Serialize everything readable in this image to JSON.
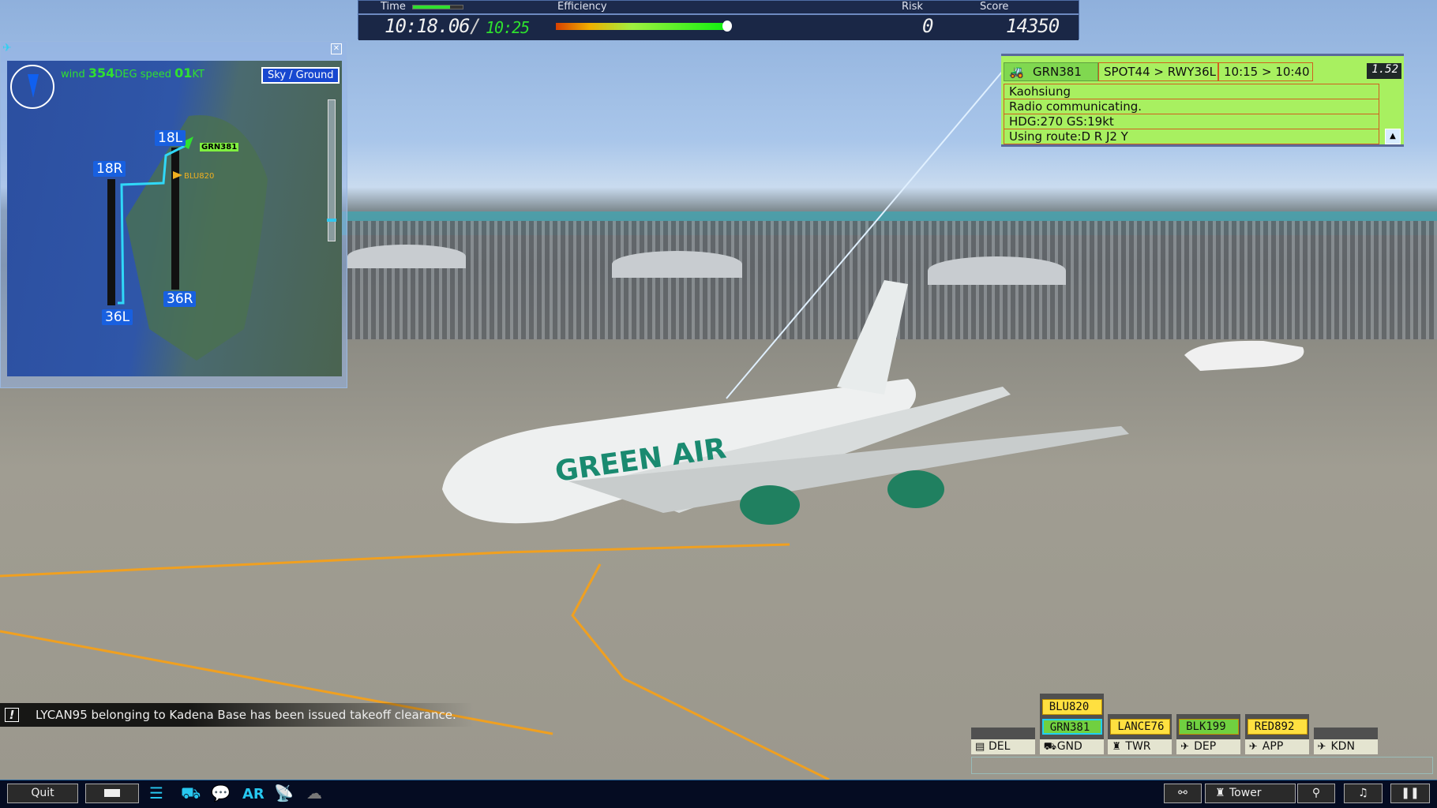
{
  "hud": {
    "time_label": "Time",
    "efficiency_label": "Efficiency",
    "risk_label": "Risk",
    "score_label": "Score",
    "clock": "10:18.06",
    "separator": "/",
    "target_time": "10:25",
    "risk": "0",
    "score": "14350",
    "efficiency_percent": 100,
    "time_progress_percent": 75
  },
  "map": {
    "wind_label": "wind",
    "wind_dir": "354",
    "wind_dir_unit": "DEG",
    "speed_label": "speed",
    "wind_speed": "01",
    "speed_unit": "KT",
    "toggle": "Sky / Ground",
    "runways": [
      "18L",
      "18R",
      "36R",
      "36L"
    ],
    "aircraft": [
      {
        "callsign": "GRN381",
        "color": "#30e030"
      },
      {
        "callsign": "BLU820",
        "color": "#f0b020"
      }
    ],
    "zoom_level_percent": 20
  },
  "info": {
    "callsign": "GRN381",
    "route": "SPOT44 > RWY36L",
    "times": "10:15 > 10:40",
    "timer": "1.52",
    "lines": [
      "Kaohsiung",
      "Radio communicating.",
      "HDG:270 GS:19kt",
      "Using route:D R J2 Y"
    ]
  },
  "message": {
    "text": "LYCAN95 belonging to Kadena Base has been issued takeoff clearance."
  },
  "strips": {
    "columns": [
      {
        "label": "DEL",
        "icon": "clipboard-icon",
        "strips": []
      },
      {
        "label": "GND",
        "icon": "car-icon",
        "strips": [
          {
            "callsign": "BLU820",
            "color": "#ffe040"
          },
          {
            "callsign": "GRN381",
            "color": "#70d040",
            "selected": true
          }
        ]
      },
      {
        "label": "TWR",
        "icon": "tower-icon",
        "strips": [
          {
            "callsign": "LANCE76",
            "color": "#ffe040"
          }
        ]
      },
      {
        "label": "DEP",
        "icon": "departure-icon",
        "strips": [
          {
            "callsign": "BLK199",
            "color": "#70d040"
          }
        ]
      },
      {
        "label": "APP",
        "icon": "arrival-icon",
        "strips": [
          {
            "callsign": "RED892",
            "color": "#ffe040"
          }
        ]
      },
      {
        "label": "KDN",
        "icon": "jet-icon",
        "strips": []
      }
    ]
  },
  "toolbar": {
    "quit": "Quit",
    "ar": "AR",
    "tower": "Tower"
  }
}
